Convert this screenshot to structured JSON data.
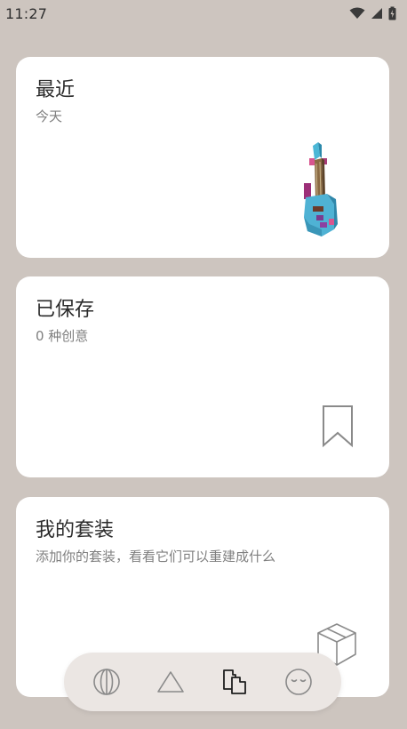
{
  "status_bar": {
    "time": "11:27",
    "icons": [
      "wifi-icon",
      "signal-icon",
      "battery-charging-icon"
    ]
  },
  "cards": {
    "recent": {
      "title": "最近",
      "subtitle": "今天",
      "art": "voxel-guitar-thumbnail"
    },
    "saved": {
      "title": "已保存",
      "subtitle": "0 种创意",
      "art": "bookmark-icon"
    },
    "bundles": {
      "title": "我的套装",
      "subtitle": "添加你的套装，看看它们可以重建成什么",
      "art": "box-icon"
    }
  },
  "bottom_nav": {
    "items": [
      {
        "icon": "globe-icon",
        "selected": false
      },
      {
        "icon": "triangle-icon",
        "selected": false
      },
      {
        "icon": "collection-icon",
        "selected": true
      },
      {
        "icon": "face-icon",
        "selected": false
      }
    ]
  },
  "colors": {
    "background": "#cdc5bf",
    "card": "#ffffff",
    "nav_background": "#ebe6e3",
    "icon_inactive": "#8a8a8a",
    "icon_active": "#1f1f1f"
  }
}
